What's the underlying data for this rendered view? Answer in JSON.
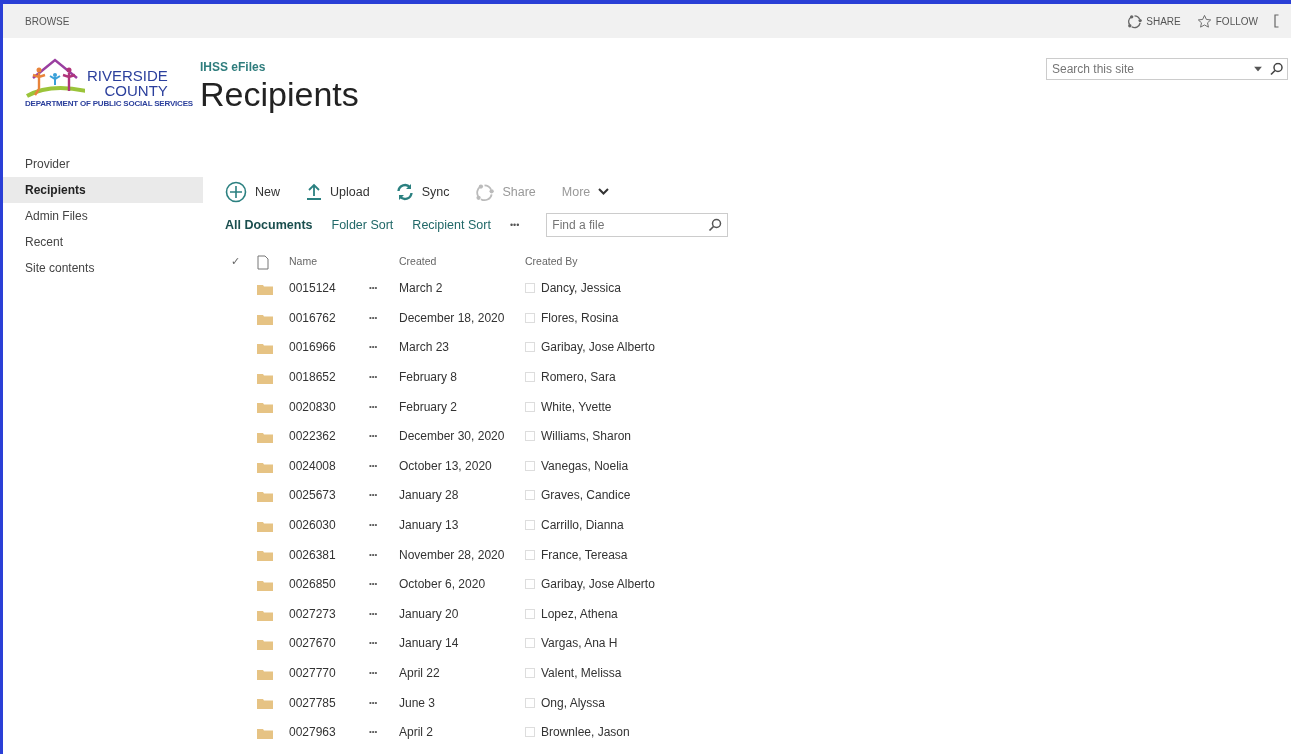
{
  "top_bar": {
    "tab": "BROWSE",
    "actions": [
      {
        "kind": "share",
        "label": "SHARE"
      },
      {
        "kind": "follow",
        "label": "FOLLOW"
      }
    ]
  },
  "logo": {
    "name": "RIVERSIDE",
    "name2": "COUNTY",
    "department": "DEPARTMENT OF PUBLIC SOCIAL SERVICES"
  },
  "site": {
    "subtitle": "IHSS eFiles",
    "title": "Recipients"
  },
  "search": {
    "placeholder": "Search this site"
  },
  "sidebar": {
    "items": [
      {
        "label": "Provider",
        "selected": false
      },
      {
        "label": "Recipients",
        "selected": true
      },
      {
        "label": "Admin Files",
        "selected": false
      },
      {
        "label": "Recent",
        "selected": false
      },
      {
        "label": "Site contents",
        "selected": false
      }
    ]
  },
  "toolbar": [
    {
      "kind": "new",
      "label": "New",
      "disabled": false
    },
    {
      "kind": "upload",
      "label": "Upload",
      "disabled": false
    },
    {
      "kind": "sync",
      "label": "Sync",
      "disabled": false
    },
    {
      "kind": "share",
      "label": "Share",
      "disabled": true
    },
    {
      "kind": "more",
      "label": "More",
      "disabled": true
    }
  ],
  "views": [
    {
      "label": "All Documents",
      "selected": true
    },
    {
      "label": "Folder Sort",
      "selected": false
    },
    {
      "label": "Recipient Sort",
      "selected": false
    }
  ],
  "views_more": "•••",
  "find": {
    "placeholder": "Find a file"
  },
  "table": {
    "check_mark": "✓",
    "columns": [
      "Name",
      "Created",
      "Created By"
    ],
    "row_menu": "•••",
    "rows": [
      {
        "name": "0015124",
        "created": "March 2",
        "created_by": "Dancy, Jessica"
      },
      {
        "name": "0016762",
        "created": "December 18, 2020",
        "created_by": "Flores, Rosina"
      },
      {
        "name": "0016966",
        "created": "March 23",
        "created_by": "Garibay, Jose Alberto"
      },
      {
        "name": "0018652",
        "created": "February 8",
        "created_by": "Romero, Sara"
      },
      {
        "name": "0020830",
        "created": "February 2",
        "created_by": "White, Yvette"
      },
      {
        "name": "0022362",
        "created": "December 30, 2020",
        "created_by": "Williams, Sharon"
      },
      {
        "name": "0024008",
        "created": "October 13, 2020",
        "created_by": "Vanegas, Noelia"
      },
      {
        "name": "0025673",
        "created": "January 28",
        "created_by": "Graves, Candice"
      },
      {
        "name": "0026030",
        "created": "January 13",
        "created_by": "Carrillo, Dianna"
      },
      {
        "name": "0026381",
        "created": "November 28, 2020",
        "created_by": "France, Tereasa"
      },
      {
        "name": "0026850",
        "created": "October 6, 2020",
        "created_by": "Garibay, Jose Alberto"
      },
      {
        "name": "0027273",
        "created": "January 20",
        "created_by": "Lopez, Athena"
      },
      {
        "name": "0027670",
        "created": "January 14",
        "created_by": "Vargas, Ana H"
      },
      {
        "name": "0027770",
        "created": "April 22",
        "created_by": "Valent, Melissa"
      },
      {
        "name": "0027785",
        "created": "June 3",
        "created_by": "Ong, Alyssa"
      },
      {
        "name": "0027963",
        "created": "April 2",
        "created_by": "Brownlee, Jason"
      }
    ]
  }
}
